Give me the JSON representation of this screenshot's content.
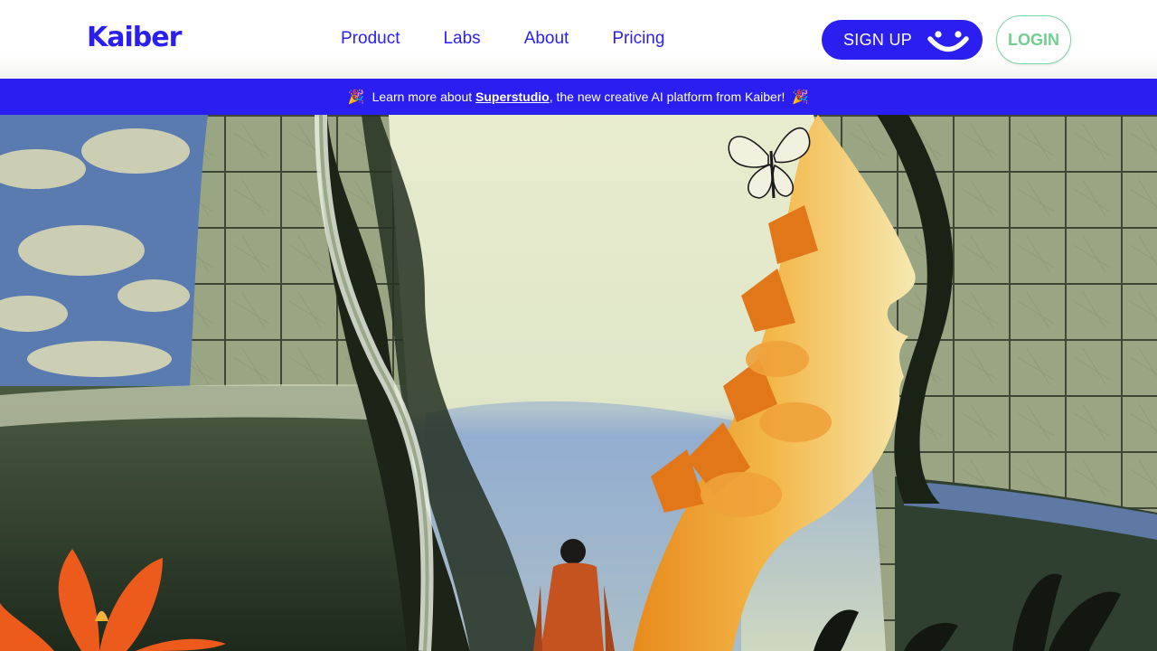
{
  "header": {
    "logo_text": "Kaiber",
    "nav": [
      {
        "label": "Product"
      },
      {
        "label": "Labs"
      },
      {
        "label": "About"
      },
      {
        "label": "Pricing"
      }
    ],
    "signup_label": "SIGN UP",
    "login_label": "LOGIN"
  },
  "banner": {
    "prefix": "Learn more about",
    "link_text": "Superstudio",
    "suffix": ", the new creative AI platform from Kaiber!",
    "emoji": "🎉"
  },
  "colors": {
    "brand_blue": "#2a1ff0",
    "login_green": "#6fcf8f",
    "white": "#ffffff"
  },
  "icons": {
    "signup_icon": "smiley-icon",
    "banner_icon": "party-popper-icon"
  }
}
